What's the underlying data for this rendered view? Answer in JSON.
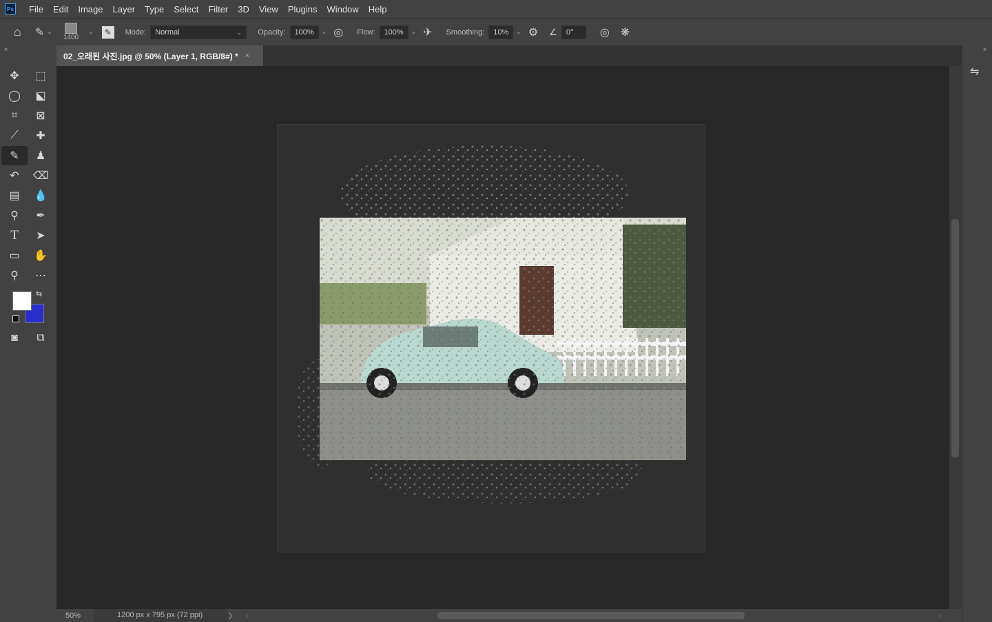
{
  "app": {
    "logo": "Ps"
  },
  "menu": [
    "File",
    "Edit",
    "Image",
    "Layer",
    "Type",
    "Select",
    "Filter",
    "3D",
    "View",
    "Plugins",
    "Window",
    "Help"
  ],
  "options": {
    "brush_size": "1400",
    "mode_label": "Mode:",
    "mode_value": "Normal",
    "opacity_label": "Opacity:",
    "opacity_value": "100%",
    "flow_label": "Flow:",
    "flow_value": "100%",
    "smoothing_label": "Smoothing:",
    "smoothing_value": "10%",
    "angle_value": "0°"
  },
  "document": {
    "tab_title": "02_오래된 사진.jpg @ 50% (Layer 1, RGB/8#) *",
    "close": "×"
  },
  "colors": {
    "foreground": "#ffffff",
    "background": "#2a2ecc"
  },
  "status": {
    "zoom": "50%",
    "info": "1200 px x 795 px (72 ppi)",
    "arrow": "〉",
    "left_arrow": "‹",
    "right_arrow": "›"
  },
  "icons": {
    "collapse_left": "«",
    "collapse_right": "»"
  }
}
